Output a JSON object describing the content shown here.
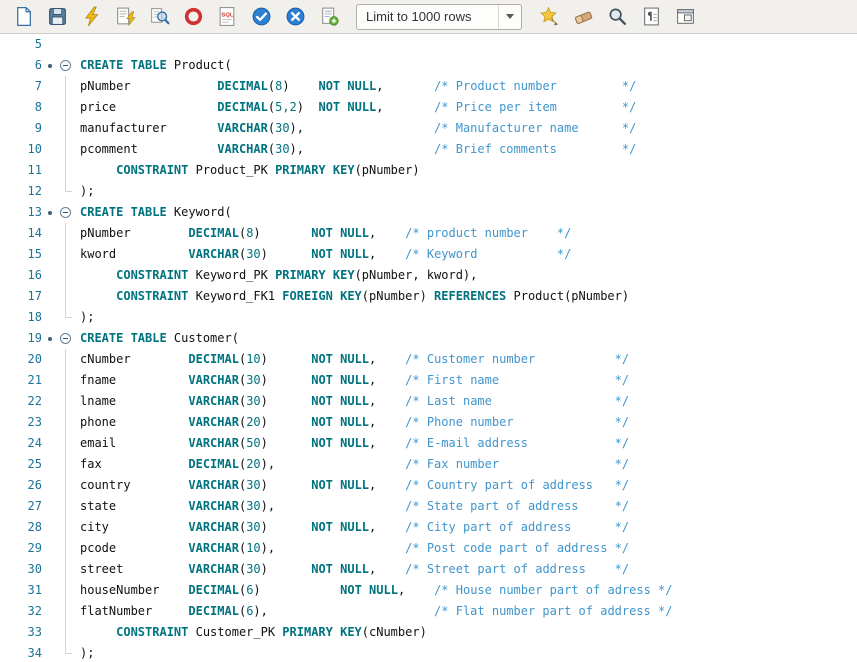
{
  "toolbar": {
    "items": [
      {
        "type": "button",
        "name": "new-document"
      },
      {
        "type": "button",
        "name": "save"
      },
      {
        "type": "button",
        "name": "run-statement"
      },
      {
        "type": "button",
        "name": "run-script"
      },
      {
        "type": "button",
        "name": "autotrace"
      },
      {
        "type": "button",
        "name": "explain-plan"
      },
      {
        "type": "button",
        "name": "sql-worksheet"
      },
      {
        "type": "button",
        "name": "commit"
      },
      {
        "type": "button",
        "name": "rollback"
      },
      {
        "type": "button",
        "name": "unshared-worksheet"
      },
      {
        "type": "dropdown",
        "name": "row-limit",
        "label": "Limit to 1000 rows"
      },
      {
        "type": "button",
        "name": "snippet-star"
      },
      {
        "type": "button",
        "name": "clear-eraser"
      },
      {
        "type": "button",
        "name": "find-search"
      },
      {
        "type": "button",
        "name": "document-outline"
      },
      {
        "type": "button",
        "name": "detach-panel"
      }
    ]
  },
  "editor": {
    "palette": {
      "keyword": "#00737f",
      "number": "#00737f",
      "comment": "#4095cc",
      "identifier": "#111111",
      "line_number": "#1c7396"
    },
    "lines": [
      {
        "n": "5",
        "fold": "",
        "tokens": []
      },
      {
        "n": "6",
        "fold": "start",
        "tokens": [
          [
            "k",
            "CREATE TABLE"
          ],
          [
            "p",
            " Product("
          ]
        ]
      },
      {
        "n": "7",
        "fold": "mid",
        "tokens": [
          [
            "p",
            "pNumber            "
          ],
          [
            "k",
            "DECIMAL"
          ],
          [
            "p",
            "("
          ],
          [
            "n",
            "8"
          ],
          [
            "p",
            ")"
          ],
          [
            "p",
            "    "
          ],
          [
            "k",
            "NOT NULL"
          ],
          [
            "p",
            ","
          ],
          [
            "p",
            "       "
          ],
          [
            "c",
            "/* Product number         */"
          ]
        ]
      },
      {
        "n": "8",
        "fold": "mid",
        "tokens": [
          [
            "p",
            "price              "
          ],
          [
            "k",
            "DECIMAL"
          ],
          [
            "p",
            "("
          ],
          [
            "n",
            "5,2"
          ],
          [
            "p",
            ")"
          ],
          [
            "p",
            "  "
          ],
          [
            "k",
            "NOT NULL"
          ],
          [
            "p",
            ","
          ],
          [
            "p",
            "       "
          ],
          [
            "c",
            "/* Price per item         */"
          ]
        ]
      },
      {
        "n": "9",
        "fold": "mid",
        "tokens": [
          [
            "p",
            "manufacturer       "
          ],
          [
            "k",
            "VARCHAR"
          ],
          [
            "p",
            "("
          ],
          [
            "n",
            "30"
          ],
          [
            "p",
            "),"
          ],
          [
            "p",
            "                  "
          ],
          [
            "c",
            "/* Manufacturer name      */"
          ]
        ]
      },
      {
        "n": "10",
        "fold": "mid",
        "tokens": [
          [
            "p",
            "pcomment           "
          ],
          [
            "k",
            "VARCHAR"
          ],
          [
            "p",
            "("
          ],
          [
            "n",
            "30"
          ],
          [
            "p",
            "),"
          ],
          [
            "p",
            "                  "
          ],
          [
            "c",
            "/* Brief comments         */"
          ]
        ]
      },
      {
        "n": "11",
        "fold": "mid",
        "tokens": [
          [
            "p",
            "     "
          ],
          [
            "k",
            "CONSTRAINT"
          ],
          [
            "p",
            " Product_PK "
          ],
          [
            "k",
            "PRIMARY KEY"
          ],
          [
            "p",
            "(pNumber)"
          ]
        ]
      },
      {
        "n": "12",
        "fold": "end",
        "tokens": [
          [
            "p",
            ");"
          ]
        ]
      },
      {
        "n": "13",
        "fold": "start",
        "tokens": [
          [
            "k",
            "CREATE TABLE"
          ],
          [
            "p",
            " Keyword("
          ]
        ]
      },
      {
        "n": "14",
        "fold": "mid",
        "tokens": [
          [
            "p",
            "pNumber        "
          ],
          [
            "k",
            "DECIMAL"
          ],
          [
            "p",
            "("
          ],
          [
            "n",
            "8"
          ],
          [
            "p",
            ")"
          ],
          [
            "p",
            "       "
          ],
          [
            "k",
            "NOT NULL"
          ],
          [
            "p",
            ","
          ],
          [
            "p",
            "    "
          ],
          [
            "c",
            "/* product number    */"
          ]
        ]
      },
      {
        "n": "15",
        "fold": "mid",
        "tokens": [
          [
            "p",
            "kword          "
          ],
          [
            "k",
            "VARCHAR"
          ],
          [
            "p",
            "("
          ],
          [
            "n",
            "30"
          ],
          [
            "p",
            ")"
          ],
          [
            "p",
            "      "
          ],
          [
            "k",
            "NOT NULL"
          ],
          [
            "p",
            ","
          ],
          [
            "p",
            "    "
          ],
          [
            "c",
            "/* Keyword           */"
          ]
        ]
      },
      {
        "n": "16",
        "fold": "mid",
        "tokens": [
          [
            "p",
            "     "
          ],
          [
            "k",
            "CONSTRAINT"
          ],
          [
            "p",
            " Keyword_PK "
          ],
          [
            "k",
            "PRIMARY KEY"
          ],
          [
            "p",
            "(pNumber, kword),"
          ]
        ]
      },
      {
        "n": "17",
        "fold": "mid",
        "tokens": [
          [
            "p",
            "     "
          ],
          [
            "k",
            "CONSTRAINT"
          ],
          [
            "p",
            " Keyword_FK1 "
          ],
          [
            "k",
            "FOREIGN KEY"
          ],
          [
            "p",
            "(pNumber) "
          ],
          [
            "k",
            "REFERENCES"
          ],
          [
            "p",
            " Product(pNumber)"
          ]
        ]
      },
      {
        "n": "18",
        "fold": "end",
        "tokens": [
          [
            "p",
            ");"
          ]
        ]
      },
      {
        "n": "19",
        "fold": "start",
        "tokens": [
          [
            "k",
            "CREATE TABLE"
          ],
          [
            "p",
            " Customer("
          ]
        ]
      },
      {
        "n": "20",
        "fold": "mid",
        "tokens": [
          [
            "p",
            "cNumber        "
          ],
          [
            "k",
            "DECIMAL"
          ],
          [
            "p",
            "("
          ],
          [
            "n",
            "10"
          ],
          [
            "p",
            ")"
          ],
          [
            "p",
            "      "
          ],
          [
            "k",
            "NOT NULL"
          ],
          [
            "p",
            ","
          ],
          [
            "p",
            "    "
          ],
          [
            "c",
            "/* Customer number           */"
          ]
        ]
      },
      {
        "n": "21",
        "fold": "mid",
        "tokens": [
          [
            "p",
            "fname          "
          ],
          [
            "k",
            "VARCHAR"
          ],
          [
            "p",
            "("
          ],
          [
            "n",
            "30"
          ],
          [
            "p",
            ")"
          ],
          [
            "p",
            "      "
          ],
          [
            "k",
            "NOT NULL"
          ],
          [
            "p",
            ","
          ],
          [
            "p",
            "    "
          ],
          [
            "c",
            "/* First name                */"
          ]
        ]
      },
      {
        "n": "22",
        "fold": "mid",
        "tokens": [
          [
            "p",
            "lname          "
          ],
          [
            "k",
            "VARCHAR"
          ],
          [
            "p",
            "("
          ],
          [
            "n",
            "30"
          ],
          [
            "p",
            ")"
          ],
          [
            "p",
            "      "
          ],
          [
            "k",
            "NOT NULL"
          ],
          [
            "p",
            ","
          ],
          [
            "p",
            "    "
          ],
          [
            "c",
            "/* Last name                 */"
          ]
        ]
      },
      {
        "n": "23",
        "fold": "mid",
        "tokens": [
          [
            "p",
            "phone          "
          ],
          [
            "k",
            "VARCHAR"
          ],
          [
            "p",
            "("
          ],
          [
            "n",
            "20"
          ],
          [
            "p",
            ")"
          ],
          [
            "p",
            "      "
          ],
          [
            "k",
            "NOT NULL"
          ],
          [
            "p",
            ","
          ],
          [
            "p",
            "    "
          ],
          [
            "c",
            "/* Phone number              */"
          ]
        ]
      },
      {
        "n": "24",
        "fold": "mid",
        "tokens": [
          [
            "p",
            "email          "
          ],
          [
            "k",
            "VARCHAR"
          ],
          [
            "p",
            "("
          ],
          [
            "n",
            "50"
          ],
          [
            "p",
            ")"
          ],
          [
            "p",
            "      "
          ],
          [
            "k",
            "NOT NULL"
          ],
          [
            "p",
            ","
          ],
          [
            "p",
            "    "
          ],
          [
            "c",
            "/* E-mail address            */"
          ]
        ]
      },
      {
        "n": "25",
        "fold": "mid",
        "tokens": [
          [
            "p",
            "fax            "
          ],
          [
            "k",
            "DECIMAL"
          ],
          [
            "p",
            "("
          ],
          [
            "n",
            "20"
          ],
          [
            "p",
            "),"
          ],
          [
            "p",
            "                  "
          ],
          [
            "c",
            "/* Fax number                */"
          ]
        ]
      },
      {
        "n": "26",
        "fold": "mid",
        "tokens": [
          [
            "p",
            "country        "
          ],
          [
            "k",
            "VARCHAR"
          ],
          [
            "p",
            "("
          ],
          [
            "n",
            "30"
          ],
          [
            "p",
            ")"
          ],
          [
            "p",
            "      "
          ],
          [
            "k",
            "NOT NULL"
          ],
          [
            "p",
            ","
          ],
          [
            "p",
            "    "
          ],
          [
            "c",
            "/* Country part of address   */"
          ]
        ]
      },
      {
        "n": "27",
        "fold": "mid",
        "tokens": [
          [
            "p",
            "state          "
          ],
          [
            "k",
            "VARCHAR"
          ],
          [
            "p",
            "("
          ],
          [
            "n",
            "30"
          ],
          [
            "p",
            "),"
          ],
          [
            "p",
            "                  "
          ],
          [
            "c",
            "/* State part of address     */"
          ]
        ]
      },
      {
        "n": "28",
        "fold": "mid",
        "tokens": [
          [
            "p",
            "city           "
          ],
          [
            "k",
            "VARCHAR"
          ],
          [
            "p",
            "("
          ],
          [
            "n",
            "30"
          ],
          [
            "p",
            ")"
          ],
          [
            "p",
            "      "
          ],
          [
            "k",
            "NOT NULL"
          ],
          [
            "p",
            ","
          ],
          [
            "p",
            "    "
          ],
          [
            "c",
            "/* City part of address      */"
          ]
        ]
      },
      {
        "n": "29",
        "fold": "mid",
        "tokens": [
          [
            "p",
            "pcode          "
          ],
          [
            "k",
            "VARCHAR"
          ],
          [
            "p",
            "("
          ],
          [
            "n",
            "10"
          ],
          [
            "p",
            "),"
          ],
          [
            "p",
            "                  "
          ],
          [
            "c",
            "/* Post code part of address */"
          ]
        ]
      },
      {
        "n": "30",
        "fold": "mid",
        "tokens": [
          [
            "p",
            "street         "
          ],
          [
            "k",
            "VARCHAR"
          ],
          [
            "p",
            "("
          ],
          [
            "n",
            "30"
          ],
          [
            "p",
            ")"
          ],
          [
            "p",
            "      "
          ],
          [
            "k",
            "NOT NULL"
          ],
          [
            "p",
            ","
          ],
          [
            "p",
            "    "
          ],
          [
            "c",
            "/* Street part of address    */"
          ]
        ]
      },
      {
        "n": "31",
        "fold": "mid",
        "tokens": [
          [
            "p",
            "houseNumber    "
          ],
          [
            "k",
            "DECIMAL"
          ],
          [
            "p",
            "("
          ],
          [
            "n",
            "6"
          ],
          [
            "p",
            ")"
          ],
          [
            "p",
            "           "
          ],
          [
            "k",
            "NOT NULL"
          ],
          [
            "p",
            ","
          ],
          [
            "p",
            "    "
          ],
          [
            "c",
            "/* House number part of adress */"
          ]
        ]
      },
      {
        "n": "32",
        "fold": "mid",
        "tokens": [
          [
            "p",
            "flatNumber     "
          ],
          [
            "k",
            "DECIMAL"
          ],
          [
            "p",
            "("
          ],
          [
            "n",
            "6"
          ],
          [
            "p",
            "),"
          ],
          [
            "p",
            "                       "
          ],
          [
            "c",
            "/* Flat number part of address */"
          ]
        ]
      },
      {
        "n": "33",
        "fold": "mid",
        "tokens": [
          [
            "p",
            "     "
          ],
          [
            "k",
            "CONSTRAINT"
          ],
          [
            "p",
            " Customer_PK "
          ],
          [
            "k",
            "PRIMARY KEY"
          ],
          [
            "p",
            "(cNumber)"
          ]
        ]
      },
      {
        "n": "34",
        "fold": "end",
        "tokens": [
          [
            "p",
            ");"
          ]
        ]
      }
    ]
  }
}
